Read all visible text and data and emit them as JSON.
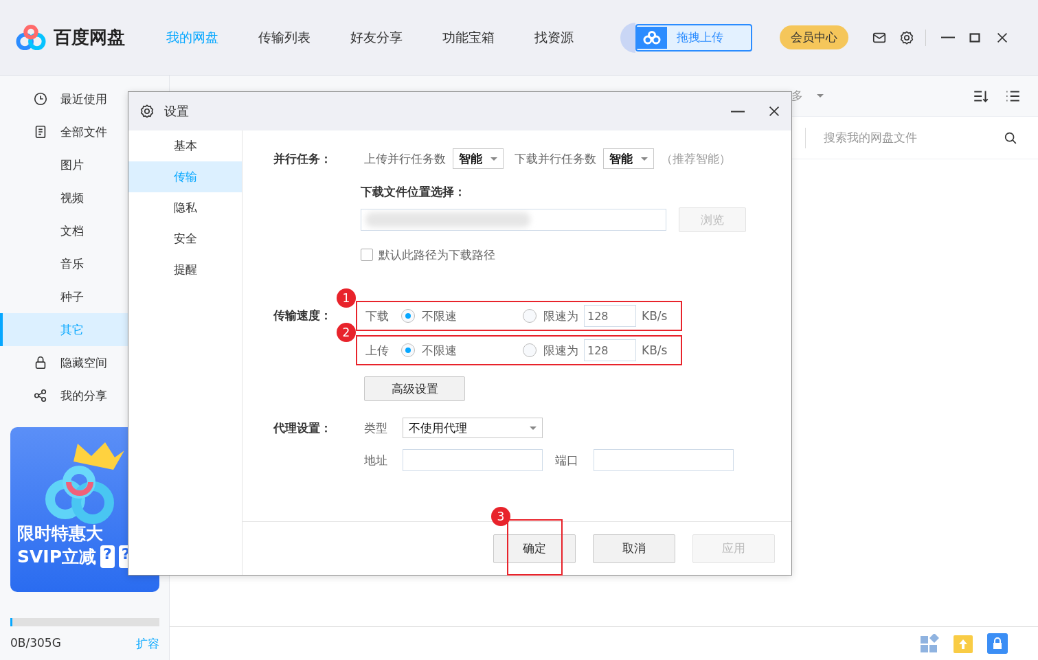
{
  "app": {
    "name": "百度网盘"
  },
  "top_tabs": [
    {
      "label": "我的网盘",
      "selected": true
    },
    {
      "label": "传输列表",
      "selected": false
    },
    {
      "label": "好友分享",
      "selected": false
    },
    {
      "label": "功能宝箱",
      "selected": false
    },
    {
      "label": "找资源",
      "selected": false
    }
  ],
  "upload_button": "拖拽上传",
  "vip_button": "会员中心",
  "sidebar": {
    "items": [
      {
        "label": "最近使用",
        "selected": false
      },
      {
        "label": "全部文件",
        "selected": false
      },
      {
        "label": "图片",
        "selected": false
      },
      {
        "label": "视频",
        "selected": false
      },
      {
        "label": "文档",
        "selected": false
      },
      {
        "label": "音乐",
        "selected": false
      },
      {
        "label": "种子",
        "selected": false
      },
      {
        "label": "其它",
        "selected": true
      },
      {
        "label": "隐藏空间",
        "selected": false
      },
      {
        "label": "我的分享",
        "selected": false
      }
    ],
    "banner": {
      "line_1": "限时特惠大",
      "line_2": "SVIP立减",
      "marks": [
        "?",
        "?"
      ]
    },
    "storage": {
      "level": 0.01,
      "usage": "0B/305G",
      "expand_link": "扩容"
    }
  },
  "main": {
    "toolbar_text": "多",
    "search": {
      "placeholder": "搜索我的网盘文件"
    }
  },
  "dialog": {
    "title": "设置",
    "nav": [
      {
        "label": "基本",
        "selected": false
      },
      {
        "label": "传输",
        "selected": true
      },
      {
        "label": "隐私",
        "selected": false
      },
      {
        "label": "安全",
        "selected": false
      },
      {
        "label": "提醒",
        "selected": false
      }
    ],
    "parallel": {
      "label": "并行任务：",
      "upload_label": "上传并行任务数",
      "upload_value": "智能",
      "download_label": "下载并行任务数",
      "download_value": "智能",
      "hint": "（推荐智能）"
    },
    "location": {
      "label": "下载文件位置选择：",
      "browse": "浏览",
      "default_checkbox": {
        "label": "默认此路径为下载路径",
        "checked": false
      }
    },
    "speed": {
      "label": "传输速度：",
      "rows": [
        {
          "callout": "1",
          "name": "下载",
          "options": [
            {
              "label": "不限速",
              "selected": true
            },
            {
              "label": "限速为",
              "selected": false
            }
          ],
          "value": "128",
          "unit": "KB/s"
        },
        {
          "callout": "2",
          "name": "上传",
          "options": [
            {
              "label": "不限速",
              "selected": true
            },
            {
              "label": "限速为",
              "selected": false
            }
          ],
          "value": "128",
          "unit": "KB/s"
        }
      ],
      "advanced": "高级设置"
    },
    "proxy": {
      "label": "代理设置：",
      "type_label": "类型",
      "type_value": "不使用代理",
      "address_label": "地址",
      "port_label": "端口"
    },
    "buttons": [
      {
        "label": "确定",
        "disabled": false,
        "callout": "3"
      },
      {
        "label": "取消",
        "disabled": false
      },
      {
        "label": "应用",
        "disabled": true
      }
    ]
  }
}
